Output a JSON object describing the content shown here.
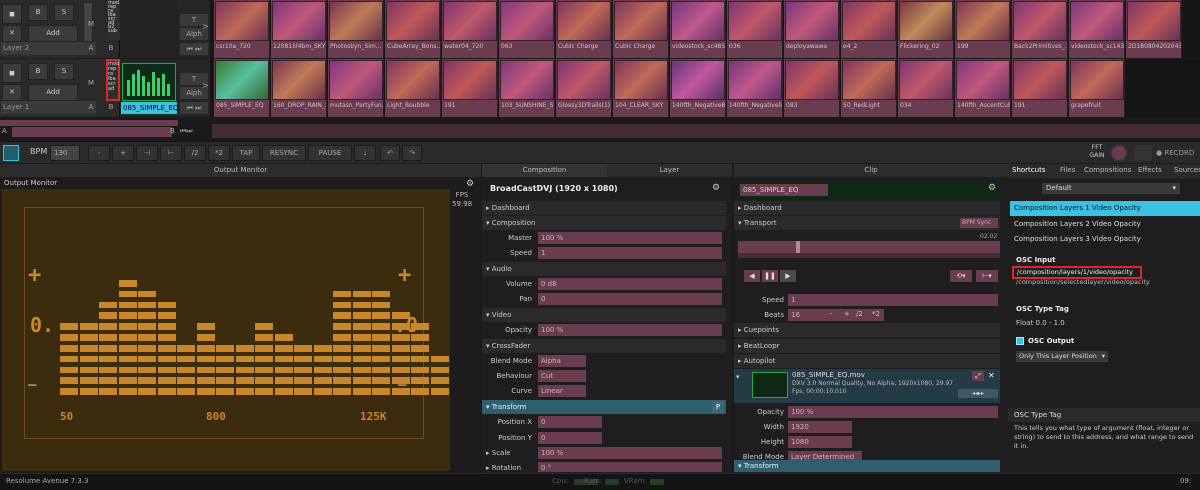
{
  "layers": [
    {
      "name": "Layer 2",
      "btn_b": "B",
      "btn_s": "S",
      "add": "Add",
      "ab_a": "A",
      "ab_b": "B",
      "m_btn": "M",
      "t_btn": "T",
      "alph": "Alph"
    },
    {
      "name": "Layer 1",
      "btn_b": "B",
      "btn_s": "S",
      "add": "Add",
      "ab_a": "A",
      "ab_b": "B",
      "m_btn": "M",
      "t_btn": "T",
      "alph": "Alph"
    }
  ],
  "layer2_popup": [
    "mod",
    "rep",
    "ra",
    "lba",
    "scr",
    "ad",
    "b2",
    "sub",
    "m",
    "mul"
  ],
  "layer1_popup": [
    "mod",
    "rep",
    "ra",
    "lba",
    "scr",
    "ad"
  ],
  "layer2_clips": [
    "csr10a_720",
    "120815l4bm_SKY",
    "Photosbyn_Sim...",
    "CubeArray_Bons...",
    "water04_720",
    "063",
    "Cubic Charge",
    "Cubic Charge",
    "videostock_sc4858",
    "036",
    "deployawawa",
    "e4_2",
    "Flickering_02",
    "199",
    "Back2Primitives_...",
    "videostock_sc1435...",
    "2D180804202043..."
  ],
  "layer1_clips": [
    "085_SIMPLE_EQ",
    "160_DROP_RAIN_2",
    "mutasn_PartyFun...",
    "Light_Boubble",
    "191",
    "103_SUNSHINE_SKY",
    "Glossy3DTrails(1)",
    "104_CLEAR_SKY",
    "140fth_NegativeB...",
    "140fth_Negativeli...",
    "083",
    "50_RedLight",
    "034",
    "140fth_AscentCube",
    "191",
    "grapefruit"
  ],
  "selected_clip": "085_SIMPLE_EQ",
  "column_row": {
    "a": "A",
    "b": "B"
  },
  "transport": {
    "bpm_label": "BPM",
    "bpm_value": "130",
    "minus": "-",
    "plus": "+",
    "half": "/2",
    "double": "*2",
    "tap": "TAP",
    "resync": "RESYNC",
    "pause": "PAUSE",
    "fft": "FFT GAIN",
    "record": "RECORD"
  },
  "output_monitor": {
    "title": "Output Monitor",
    "label": "Output Monitor",
    "fps_label": "FPS",
    "fps_value": "59.98",
    "eq_left_value": "0.",
    "eq_right_value": ".0",
    "plus_glyph": "+",
    "minus_glyph": "—",
    "freq_labels": [
      "50",
      "800",
      "125K"
    ],
    "levels": [
      0.55,
      0.55,
      0.75,
      0.95,
      0.85,
      0.75,
      0.45,
      0.55,
      0.4,
      0.4,
      0.6,
      0.5,
      0.4,
      0.4,
      0.8,
      0.85,
      0.8,
      0.65,
      0.55,
      0.3
    ]
  },
  "composition_panel": {
    "tab": "Composition",
    "title": "BroadCastDVJ (1920 x 1080)",
    "dashboard": "Dashboard",
    "composition": "Composition",
    "master_label": "Master",
    "master_value": "100 %",
    "speed_label": "Speed",
    "speed_value": "1",
    "audio": "Audio",
    "volume_label": "Volume",
    "volume_value": "0 dB",
    "pan_label": "Pan",
    "pan_value": "0",
    "video": "Video",
    "opacity_label": "Opacity",
    "opacity_value": "100 %",
    "crossfader": "CrossFader",
    "blend_label": "Blend Mode",
    "blend_value": "Alpha",
    "behaviour_label": "Behaviour",
    "behaviour_value": "Cut",
    "curve_label": "Curve",
    "curve_value": "Linear",
    "transform": "Transform",
    "pos_x_label": "Position X",
    "pos_x_value": "0",
    "pos_y_label": "Position Y",
    "pos_y_value": "0",
    "scale_label": "Scale",
    "scale_value": "100 %",
    "rotation_label": "Rotation",
    "rotation_value": "0 °",
    "p_btn": "P"
  },
  "layer_tab": "Layer",
  "clip_panel": {
    "tab": "Clip",
    "clip_name": "085_SIMPLE_EQ",
    "dashboard": "Dashboard",
    "transport": "Transport",
    "bpm_sync": "BPM Sync",
    "time": "02.02",
    "speed_label": "Speed",
    "speed_value": "1",
    "beats_label": "Beats",
    "beats_value": "16",
    "cuepoints": "Cuepoints",
    "beatloopr": "BeatLoopr",
    "autopilot": "Autopilot",
    "file_name": "085_SIMPLE_EQ.mov",
    "file_info1": "DXV 3.0 Normal Quality, No Alpha, 1920x1080, 29.97",
    "file_info2": "Fps, 00:00:10.010",
    "opacity_label": "Opacity",
    "opacity_value": "100 %",
    "width_label": "Width",
    "width_value": "1920",
    "height_label": "Height",
    "height_value": "1080",
    "blend_label": "Blend Mode",
    "blend_value": "Layer Determined",
    "transform": "Transform"
  },
  "right_tabs": [
    "Shortcuts",
    "Files",
    "Compositions",
    "Effects",
    "Sources"
  ],
  "shortcuts": {
    "preset": "Default",
    "items": [
      "Composition Layers 1 Video Opacity",
      "Composition Layers 2 Video Opacity",
      "Composition Layers 3 Video Opacity"
    ],
    "osc_input_label": "OSC Input",
    "osc_input_value": "/composition/layers/1/video/opacity",
    "osc_input_value2": "/composition/selectedlayer/video/opacity",
    "osc_type_label": "OSC Type Tag",
    "osc_type_value": "Float 0.0 - 1.0",
    "osc_output_label": "OSC Output",
    "osc_output_value": "Only This Layer Position",
    "help_title": "OSC Type Tag",
    "help_text": "This tells you what type of argument (float, integer or string) to send to this address, and what range to send it in."
  },
  "status": {
    "app": "Resolume Avenue 7.3.3",
    "cpu": "Cpu:",
    "ram": "Ram:",
    "vram": "VRam:",
    "clock": "09:"
  },
  "colors": {
    "clip_pink": "#6a3c4f",
    "accent_cyan": "#3ec0e0",
    "eq_orange": "#c8882a",
    "highlight_red": "#e0262c"
  }
}
